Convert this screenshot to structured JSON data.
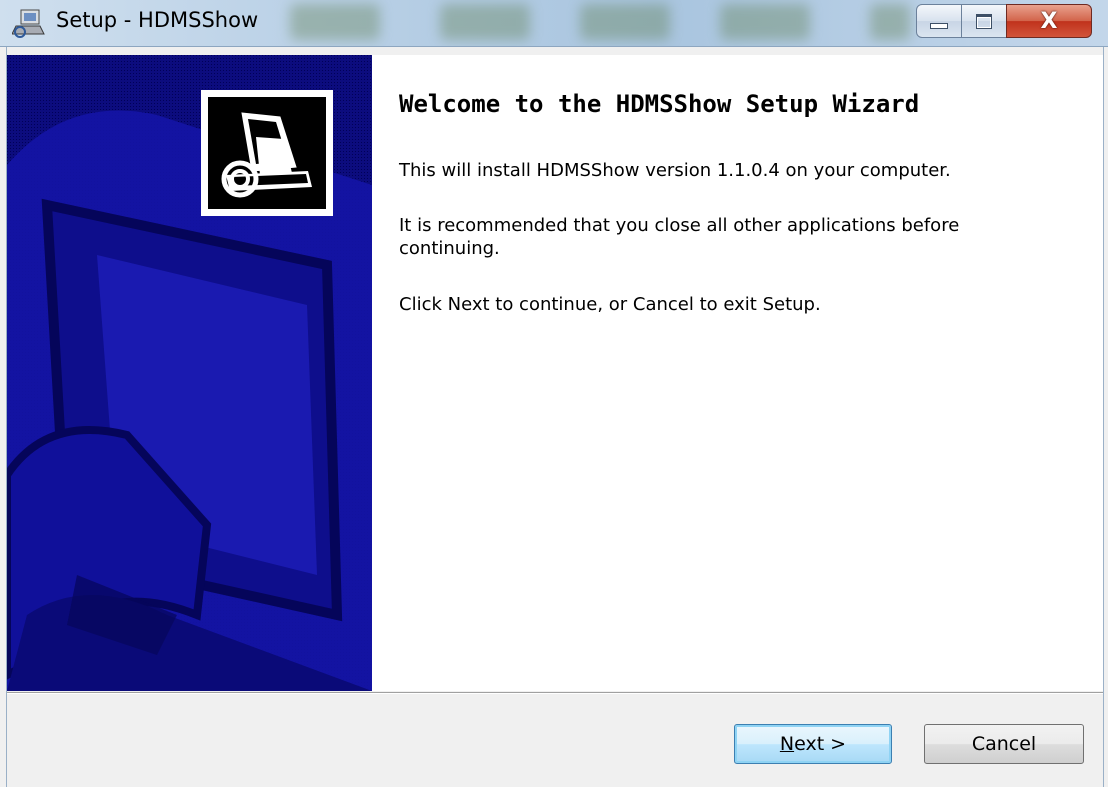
{
  "window": {
    "title": "Setup - HDMSShow"
  },
  "caption_buttons": {
    "minimize": "minimize-icon",
    "maximize": "maximize-icon",
    "close_glyph": "X"
  },
  "wizard": {
    "heading": "Welcome to the HDMSShow Setup Wizard",
    "paragraphs": [
      "This will install HDMSShow version 1.1.0.4 on your computer.",
      "It is recommended that you close all other applications before continuing.",
      "Click Next to continue, or Cancel to exit Setup."
    ]
  },
  "buttons": {
    "next_accel": "N",
    "next_rest": "ext >",
    "cancel": "Cancel"
  },
  "colors": {
    "sidebar": "#0c0c7e",
    "sidebar_shape": "#1a1ab0"
  }
}
